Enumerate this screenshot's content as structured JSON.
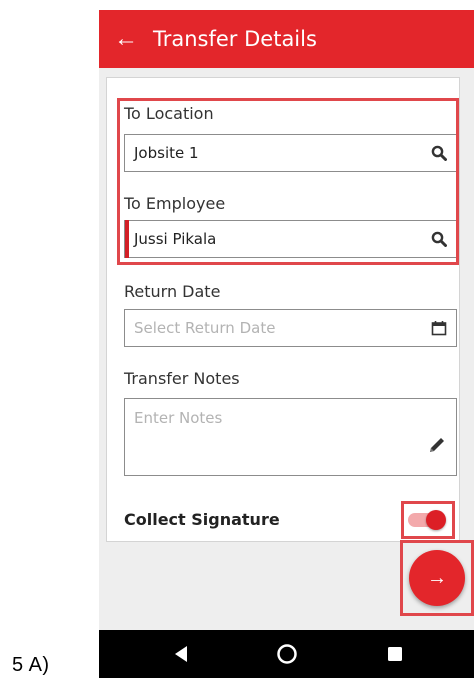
{
  "caption": "5   A)",
  "appbar": {
    "back_glyph": "←",
    "title": "Transfer Details"
  },
  "form": {
    "to_location": {
      "label": "To Location",
      "value": "Jobsite 1",
      "icon": "search-icon"
    },
    "to_employee": {
      "label": "To Employee",
      "value": "Jussi Pikala",
      "icon": "search-icon"
    },
    "return_date": {
      "label": "Return Date",
      "placeholder": "Select Return Date",
      "icon": "calendar-icon"
    },
    "transfer_notes": {
      "label": "Transfer Notes",
      "placeholder": "Enter Notes",
      "icon": "pencil-icon"
    },
    "collect_signature": {
      "label": "Collect Signature",
      "enabled": true
    }
  },
  "fab": {
    "glyph": "→"
  },
  "colors": {
    "accent": "#e3262b",
    "highlight": "#e0474b",
    "background": "#eeeeee",
    "navbar": "#000000"
  },
  "navbar": {
    "buttons": [
      "back-icon",
      "home-icon",
      "recents-icon"
    ]
  }
}
